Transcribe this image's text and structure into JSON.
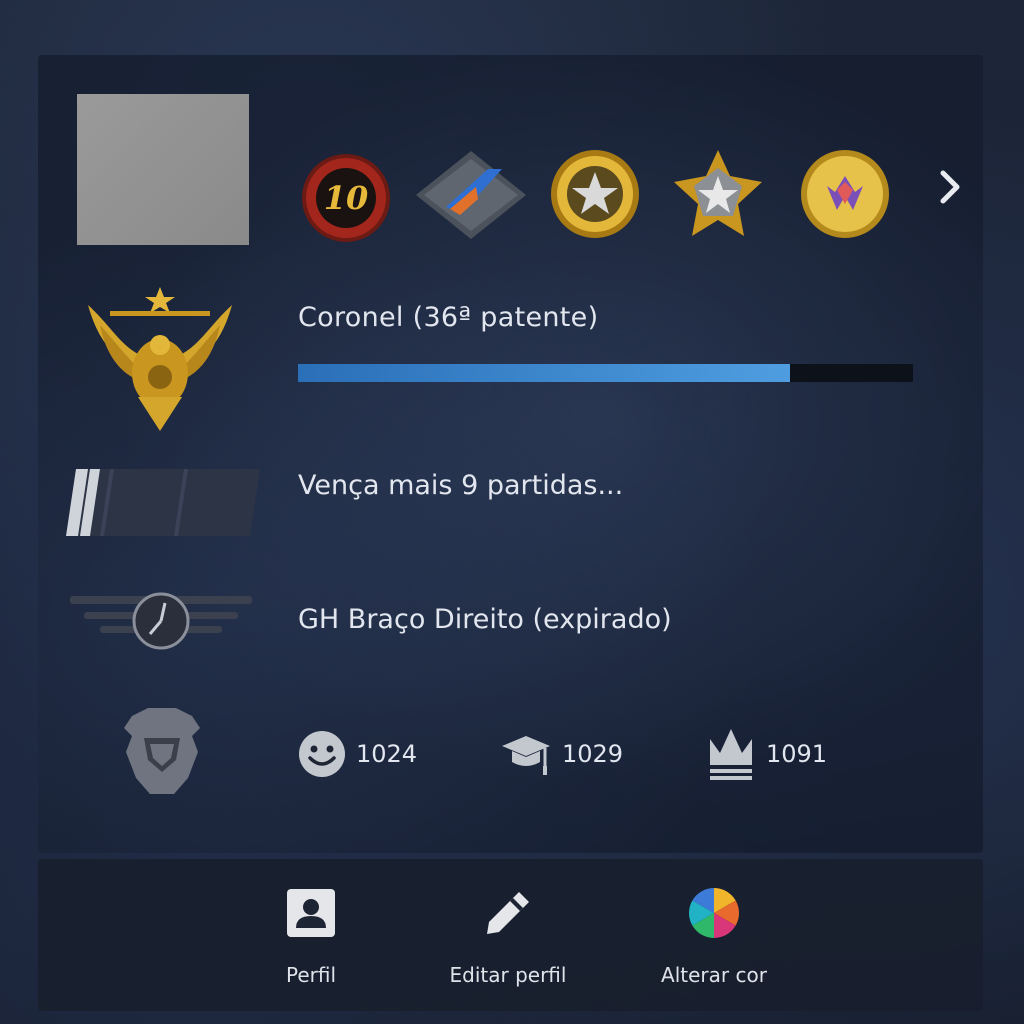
{
  "profile": {
    "rank_name": "Coronel (36ª patente)",
    "xp_progress": 0.8,
    "wins_text": "Vença mais 9 partidas...",
    "service_medal_text": "GH Braço Direito (expirado)",
    "pins": [
      {
        "icon": "ten-year-coin-icon",
        "label": "10"
      },
      {
        "icon": "operation-coin-icon"
      },
      {
        "icon": "gold-star-coin-icon"
      },
      {
        "icon": "star-pentagon-pin-icon"
      },
      {
        "icon": "gold-crest-coin-icon"
      }
    ],
    "stats": {
      "friendly": "1024",
      "teacher": "1029",
      "leader": "1091"
    }
  },
  "actions": {
    "profile_label": "Perfil",
    "edit_label": "Editar perfil",
    "color_label": "Alterar cor"
  },
  "colors": {
    "xp_fill": "#4f9de0",
    "gold": "#d4a72c"
  }
}
